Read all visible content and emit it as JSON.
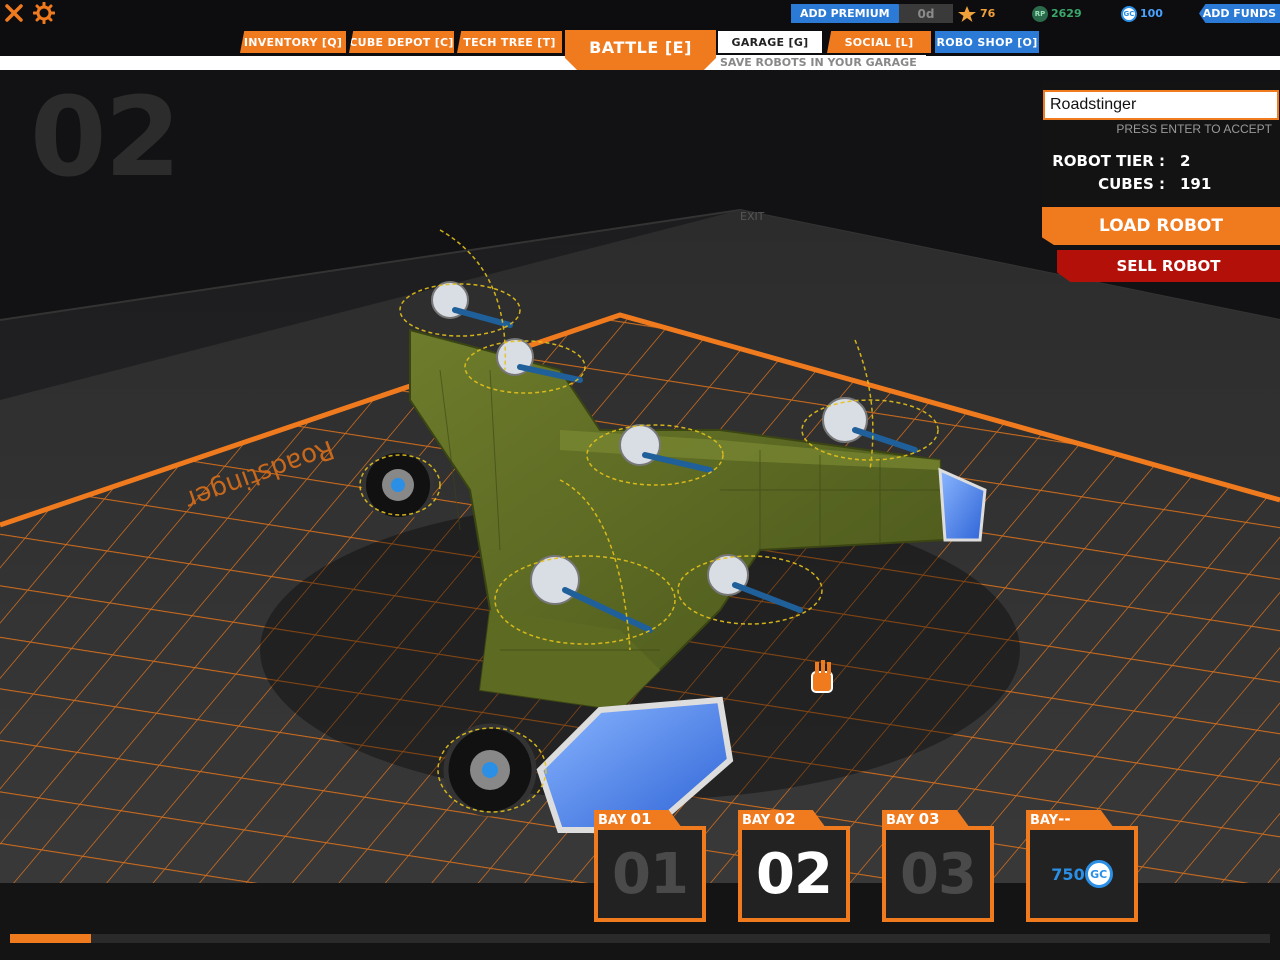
{
  "topbar": {
    "premium_label": "ADD PREMIUM",
    "premium_days": "0d",
    "tech_points": "76",
    "robot_points": "2629",
    "gc_amount": "100",
    "funds_label": "ADD FUNDS",
    "rp_icon_text": "RP",
    "gc_icon_text": "GC"
  },
  "tabs": [
    {
      "label": "INVENTORY [Q]"
    },
    {
      "label": "CUBE DEPOT [C]"
    },
    {
      "label": "TECH TREE [T]"
    },
    {
      "label": "BATTLE [E]"
    },
    {
      "label": "GARAGE [G]"
    },
    {
      "label": "SOCIAL [L]"
    },
    {
      "label": "ROBO SHOP [O]"
    }
  ],
  "garage_hint": "SAVE ROBOTS IN YOUR GARAGE",
  "bay_watermark": "02",
  "robot_panel": {
    "name_value": "Roadstinger",
    "press_enter": "PRESS ENTER TO ACCEPT",
    "tier_label": "ROBOT TIER :",
    "tier_value": "2",
    "cubes_label": "CUBES :",
    "cubes_value": "191",
    "load_label": "LOAD ROBOT",
    "sell_label": "SELL ROBOT"
  },
  "floor_label": "Roadstinger",
  "floor_exit": "EXIT",
  "bays": [
    {
      "tab": "BAY",
      "num": "01",
      "big": "01",
      "state": "dim"
    },
    {
      "tab": "BAY",
      "num": "02",
      "big": "02",
      "state": "active"
    },
    {
      "tab": "BAY",
      "num": "03",
      "big": "03",
      "state": "dim"
    },
    {
      "tab": "BAY",
      "num": "--",
      "price": "750",
      "state": "locked"
    }
  ],
  "progress_fraction": 0.064,
  "colors": {
    "accent": "#f07a1e",
    "premium_blue": "#2b7bd6",
    "sell_red": "#b4100a",
    "gc_blue": "#2b8fe6",
    "rp_green": "#3aa86b",
    "robot_green": "#5b6a22"
  }
}
